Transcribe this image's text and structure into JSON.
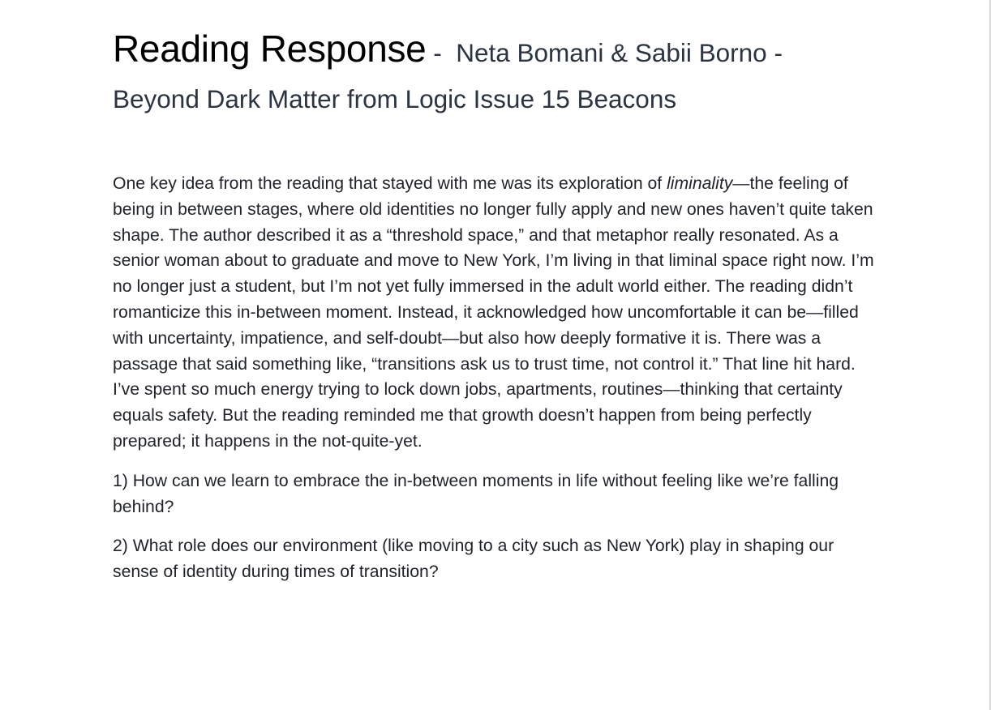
{
  "document": {
    "title_main": "Reading Response",
    "title_sep": " -  ",
    "title_authors": "Neta Bomani & Sabii Borno -",
    "title_line2": "Beyond Dark Matter from Logic Issue 15 Beacons",
    "paragraph1": {
      "before_em": "One key idea from the reading that stayed with me was its exploration of ",
      "em": "liminality",
      "after_em": "—the feeling of being in between stages, where old identities no longer fully apply and new ones haven’t quite taken shape. The author described it as a “threshold space,” and that metaphor really resonated. As a senior woman about to graduate and move to New York, I’m living in that liminal space right now. I’m no longer just a student, but I’m not yet fully immersed in the adult world either. The reading didn’t romanticize this in-between moment. Instead, it acknowledged how uncomfortable it can be—filled with uncertainty, impatience, and self-doubt—but also how deeply formative it is. There was a passage that said something like, “transitions ask us to trust time, not control it.” That line hit hard. I’ve spent so much energy trying to lock down jobs, apartments, routines—thinking that certainty equals safety. But the reading reminded me that growth doesn’t happen from being perfectly prepared; it happens in the not-quite-yet."
    },
    "question1": "1) How can we learn to embrace the in-between moments in life without feeling like we’re falling behind?",
    "question2": "2) What role does our environment (like moving to a city such as New York) play in shaping our sense of identity during times of transition?"
  }
}
